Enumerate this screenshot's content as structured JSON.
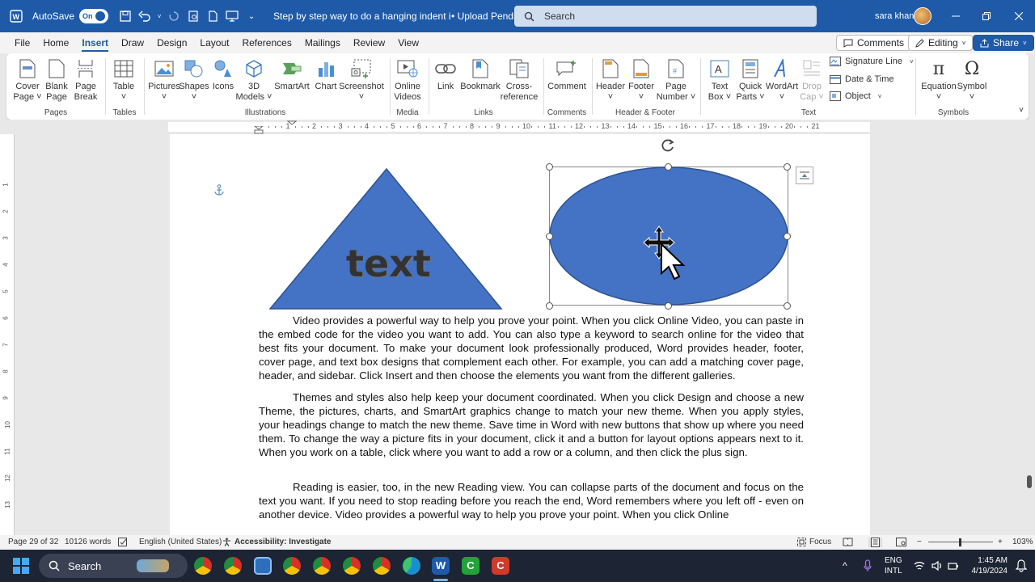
{
  "titlebar": {
    "autosave_label": "AutoSave",
    "autosave_state": "On",
    "doc_title": "Step by step way to do a hanging indent in Ms...",
    "upload_status": "• Upload Pending",
    "search_placeholder": "Search",
    "user_name": "sara khan"
  },
  "ribbon_tabs": [
    "File",
    "Home",
    "Insert",
    "Draw",
    "Design",
    "Layout",
    "References",
    "Mailings",
    "Review",
    "View"
  ],
  "active_tab": "Insert",
  "tab_buttons": {
    "comments": "Comments",
    "editing": "Editing",
    "share": "Share"
  },
  "ribbon": {
    "pages": {
      "label": "Pages",
      "cover": "Cover\nPage ˅",
      "blank": "Blank\nPage",
      "break": "Page\nBreak"
    },
    "tables": {
      "label": "Tables",
      "table": "Table\n˅"
    },
    "illustrations": {
      "label": "Illustrations",
      "pictures": "Pictures\n˅",
      "shapes": "Shapes\n˅",
      "icons": "Icons",
      "models": "3D\nModels ˅",
      "smartart": "SmartArt",
      "chart": "Chart",
      "screenshot": "Screenshot\n˅"
    },
    "media": {
      "label": "Media",
      "online_videos": "Online\nVideos"
    },
    "links": {
      "label": "Links",
      "link": "Link",
      "bookmark": "Bookmark",
      "crossref": "Cross-\nreference"
    },
    "comments": {
      "label": "Comments",
      "comment": "Comment"
    },
    "header_footer": {
      "label": "Header & Footer",
      "header": "Header\n˅",
      "footer": "Footer\n˅",
      "page_number": "Page\nNumber ˅"
    },
    "text": {
      "label": "Text",
      "text_box": "Text\nBox ˅",
      "quick_parts": "Quick\nParts ˅",
      "wordart": "WordArt\n˅",
      "drop_cap": "Drop\nCap ˅",
      "signature_line": "Signature Line",
      "date_time": "Date & Time",
      "object": "Object"
    },
    "symbols": {
      "label": "Symbols",
      "equation": "Equation\n˅",
      "symbol": "Symbol\n˅"
    }
  },
  "ruler": {
    "h_numbers": [
      "1",
      "2",
      "3",
      "4",
      "5",
      "6",
      "7",
      "8",
      "9",
      "10",
      "11",
      "12",
      "13",
      "14",
      "15",
      "16",
      "17",
      "18",
      "19",
      "20",
      "21"
    ],
    "v_numbers": [
      "1",
      "2",
      "3",
      "4",
      "5",
      "6",
      "7",
      "8",
      "9",
      "10",
      "11",
      "12",
      "13"
    ]
  },
  "document": {
    "triangle_text": "text",
    "shape_fill": "#4472c4",
    "paragraphs": [
      "Video provides a powerful way to help you prove your point. When you click Online Video, you can paste in the embed code for the video you want to add. You can also type a keyword to search online for the video that best fits your document. To make your document look professionally produced, Word provides header, footer, cover page, and text box designs that complement each other. For example, you can add a matching cover page, header, and sidebar. Click Insert and then choose the elements you want from the different galleries.",
      "Themes and styles also help keep your document coordinated. When you click Design and choose a new Theme, the pictures, charts, and SmartArt graphics change to match your new theme. When you apply styles, your headings change to match the new theme. Save time in Word with new buttons that show up where you need them. To change the way a picture fits in your document, click it and a button for layout options appears next to it. When you work on a table, click where you want to add a row or a column, and then click the plus sign.",
      "Reading is easier, too, in the new Reading view. You can collapse parts of the document and focus on the text you want. If you need to stop reading before you reach the end, Word remembers where you left off - even on another device. Video provides a powerful way to help you prove your point. When you click Online"
    ]
  },
  "statusbar": {
    "page": "Page 29 of 32",
    "words": "10126 words",
    "language": "English (United States)",
    "accessibility": "Accessibility: Investigate",
    "focus": "Focus",
    "zoom": "103%"
  },
  "taskbar": {
    "search": "Search",
    "lang_line1": "ENG",
    "lang_line2": "INTL",
    "time": "1:45 AM",
    "date": "4/19/2024"
  },
  "colors": {
    "word_blue": "#1e5aa8",
    "taskbar": "#1d2433"
  }
}
